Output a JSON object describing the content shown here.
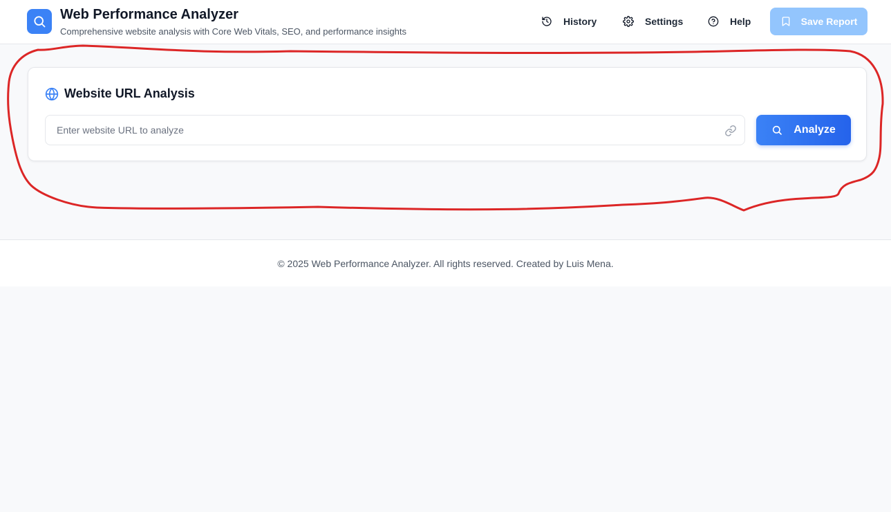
{
  "header": {
    "title": "Web Performance Analyzer",
    "subtitle": "Comprehensive website analysis with Core Web Vitals, SEO, and performance insights",
    "logo_icon": "search-icon",
    "nav": [
      {
        "label": "History",
        "icon": "history-icon"
      },
      {
        "label": "Settings",
        "icon": "gear-icon"
      },
      {
        "label": "Help",
        "icon": "help-circle-icon"
      }
    ],
    "save_label": "Save Report",
    "save_icon": "bookmark-icon"
  },
  "analysis": {
    "title": "Website URL Analysis",
    "title_icon": "globe-icon",
    "url_placeholder": "Enter website URL to analyze",
    "url_value": "",
    "input_icon": "link-icon",
    "analyze_label": "Analyze",
    "analyze_icon": "search-icon"
  },
  "footer": {
    "text": "© 2025 Web Performance Analyzer. All rights reserved. Created by Luis Mena."
  },
  "colors": {
    "accent": "#3b82f6",
    "accent_dark": "#2563eb",
    "save_disabled": "#93c5fd",
    "annotation": "#dc2626",
    "background": "#f8f9fb"
  }
}
